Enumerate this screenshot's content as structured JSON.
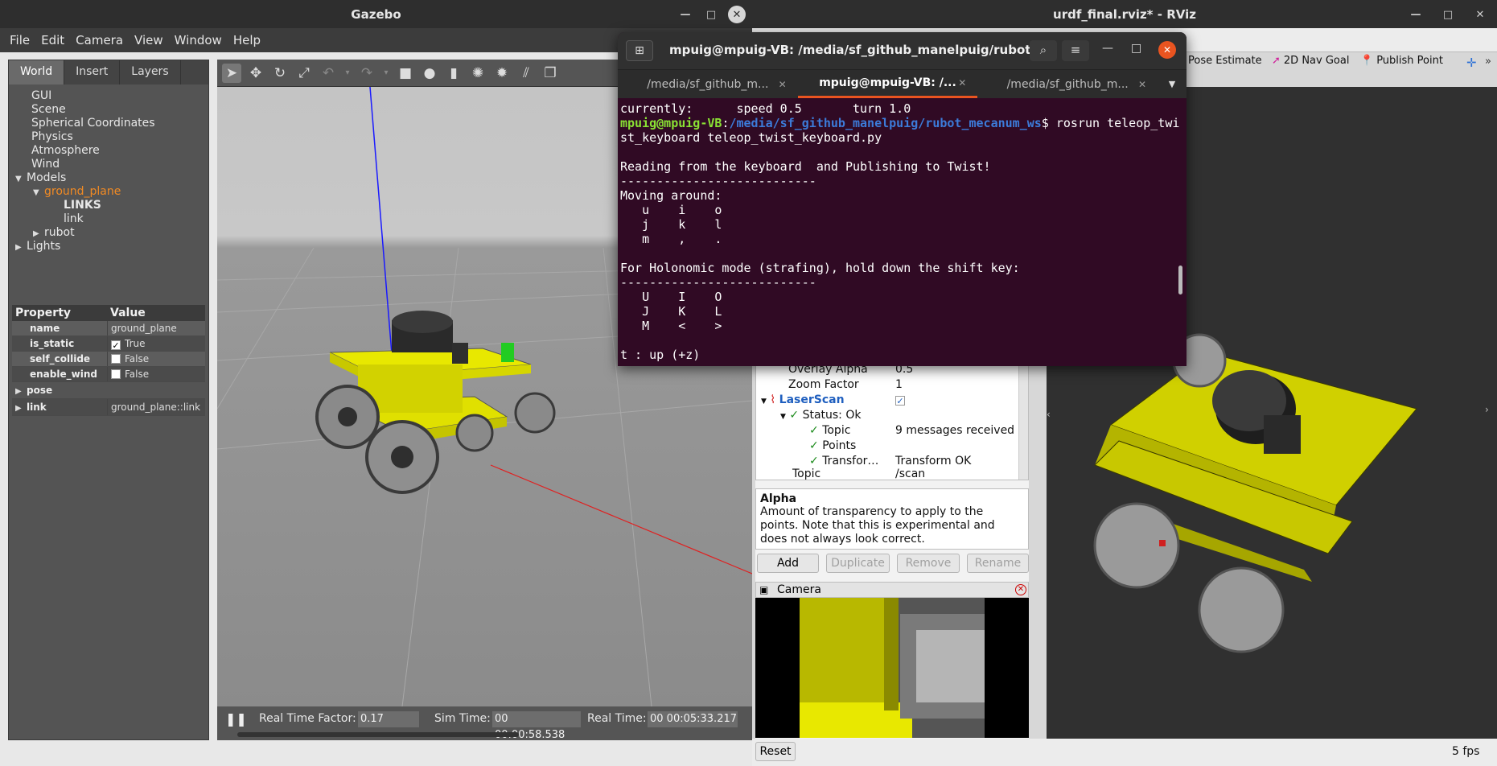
{
  "gazebo": {
    "title": "Gazebo",
    "menu": [
      "File",
      "Edit",
      "Camera",
      "View",
      "Window",
      "Help"
    ],
    "tabs": [
      "World",
      "Insert",
      "Layers"
    ],
    "tree": {
      "gui": "GUI",
      "scene": "Scene",
      "spherical": "Spherical Coordinates",
      "physics": "Physics",
      "atmosphere": "Atmosphere",
      "wind": "Wind",
      "models": "Models",
      "ground_plane": "ground_plane",
      "links": "LINKS",
      "link": "link",
      "rubot": "rubot",
      "lights": "Lights"
    },
    "props": {
      "header_property": "Property",
      "header_value": "Value",
      "name_k": "name",
      "name_v": "ground_plane",
      "is_static_k": "is_static",
      "is_static_v": "True",
      "self_collide_k": "self_collide",
      "self_collide_v": "False",
      "enable_wind_k": "enable_wind",
      "enable_wind_v": "False",
      "pose_k": "pose",
      "link_k": "link",
      "link_v": "ground_plane::link"
    },
    "status": {
      "rtf_label": "Real Time Factor:",
      "rtf_value": "0.17",
      "sim_label": "Sim Time:",
      "sim_value": "00 00:00:58.538",
      "real_label": "Real Time:",
      "real_value": "00 00:05:33.217"
    }
  },
  "rviz": {
    "title": "urdf_final.rviz* - RViz",
    "tools": {
      "pose": "Pose Estimate",
      "nav": "2D Nav Goal",
      "point": "Publish Point"
    },
    "displays": {
      "overlay_alpha_k": "Overlay Alpha",
      "overlay_alpha_v": "0.5",
      "zoom_k": "Zoom Factor",
      "zoom_v": "1",
      "laser": "LaserScan",
      "status": "Status: Ok",
      "topic_k": "Topic",
      "topic_v": "9 messages received",
      "points_k": "Points",
      "transform_k": "Transfor…",
      "transform_v": "Transform OK",
      "topic2_k": "Topic",
      "topic2_v": "/scan"
    },
    "help": {
      "title": "Alpha",
      "text": "Amount of transparency to apply to the points. Note that this is experimental and does not always look correct."
    },
    "buttons": {
      "add": "Add",
      "duplicate": "Duplicate",
      "remove": "Remove",
      "rename": "Rename",
      "reset": "Reset"
    },
    "camera_title": "Camera",
    "fps": "5 fps"
  },
  "terminal": {
    "title": "mpuig@mpuig-VB: /media/sf_github_manelpuig/rubot_...",
    "tabs": [
      "/media/sf_github_m...",
      "mpuig@mpuig-VB: /...",
      "/media/sf_github_m..."
    ],
    "line1": "currently:\tspeed 0.5\tturn 1.0 ",
    "prompt_user": "mpuig@mpuig-VB",
    "prompt_path": "/media/sf_github_manelpuig/rubot_mecanum_ws",
    "command": "$ rosrun teleop_twi",
    "command2": "st_keyboard teleop_twist_keyboard.py",
    "body": "\nReading from the keyboard  and Publishing to Twist!\n---------------------------\nMoving around:\n   u    i    o\n   j    k    l\n   m    ,    .\n\nFor Holonomic mode (strafing), hold down the shift key:\n---------------------------\n   U    I    O\n   J    K    L\n   M    <    >\n\nt : up (+z)"
  },
  "colors": {
    "accent_orange": "#e95420",
    "terminal_bg": "#300a24",
    "robot_yellow": "#f4f400"
  }
}
